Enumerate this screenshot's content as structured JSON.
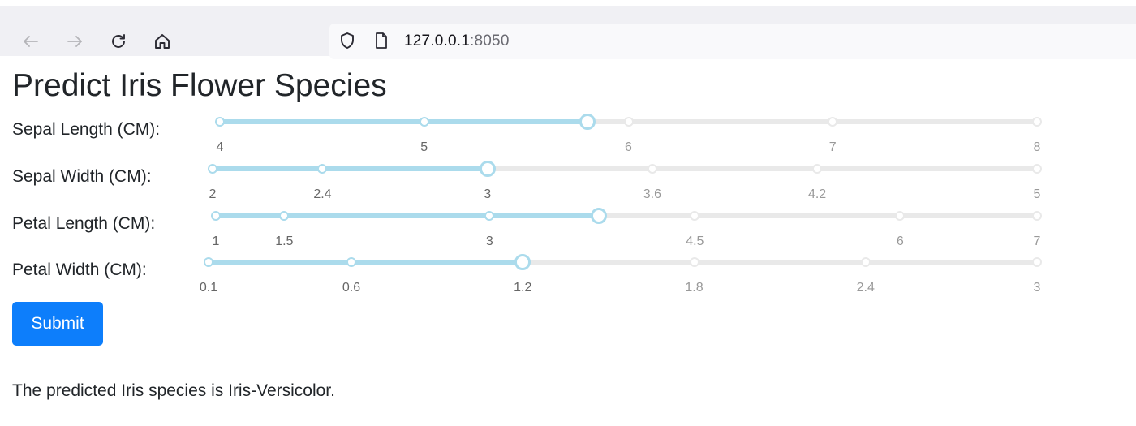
{
  "browser": {
    "url_host": "127.0.0.1",
    "url_port": ":8050",
    "icons": [
      "back-arrow-icon",
      "forward-arrow-icon",
      "reload-icon",
      "home-icon",
      "shield-icon",
      "page-icon"
    ]
  },
  "page": {
    "title": "Predict Iris Flower Species",
    "sliders": [
      {
        "label": "Sepal Length (CM):",
        "min": 4,
        "max": 8,
        "value": 5.8,
        "marks": [
          "4",
          "5",
          "6",
          "7",
          "8"
        ],
        "mark_values": [
          4,
          5,
          6,
          7,
          8
        ]
      },
      {
        "label": "Sepal Width (CM):",
        "min": 2,
        "max": 5,
        "value": 3,
        "marks": [
          "2",
          "2.4",
          "3",
          "3.6",
          "4.2",
          "5"
        ],
        "mark_values": [
          2,
          2.4,
          3,
          3.6,
          4.2,
          5
        ]
      },
      {
        "label": "Petal Length (CM):",
        "min": 1,
        "max": 7,
        "value": 3.8,
        "marks": [
          "1",
          "1.5",
          "3",
          "4.5",
          "6",
          "7"
        ],
        "mark_values": [
          1,
          1.5,
          3,
          4.5,
          6,
          7
        ]
      },
      {
        "label": "Petal Width (CM):",
        "min": 0.1,
        "max": 3,
        "value": 1.2,
        "marks": [
          "0.1",
          "0.6",
          "1.2",
          "1.8",
          "2.4",
          "3"
        ],
        "mark_values": [
          0.1,
          0.6,
          1.2,
          1.8,
          2.4,
          3
        ]
      }
    ],
    "submit_label": "Submit",
    "result_text": "The predicted Iris species is Iris-Versicolor."
  },
  "colors": {
    "track_active": "#abdbec",
    "rail": "#e9e9e9",
    "submit_bg": "#0d7efb"
  }
}
